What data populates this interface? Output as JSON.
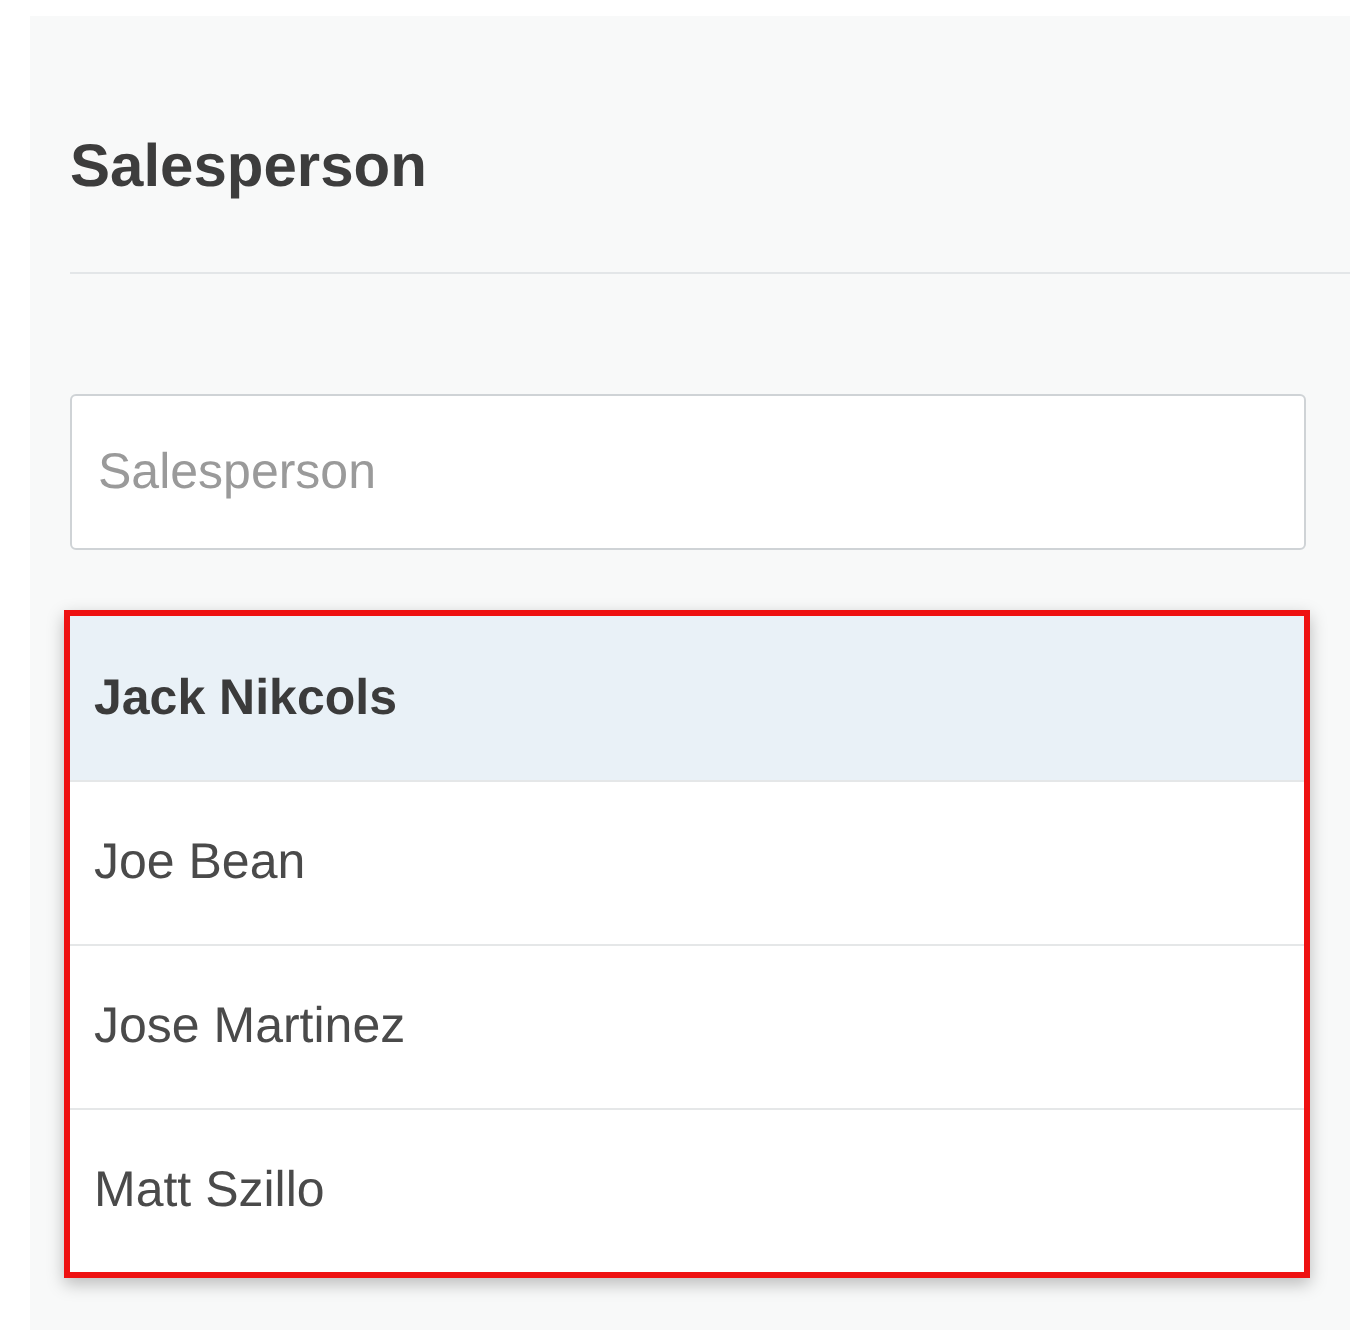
{
  "title": "Salesperson",
  "search": {
    "placeholder": "Salesperson"
  },
  "list": {
    "highlighted": true,
    "items": [
      {
        "label": "Jack Nikcols",
        "selected": true
      },
      {
        "label": "Joe Bean",
        "selected": false
      },
      {
        "label": "Jose Martinez",
        "selected": false
      },
      {
        "label": "Matt Szillo",
        "selected": false
      }
    ]
  }
}
